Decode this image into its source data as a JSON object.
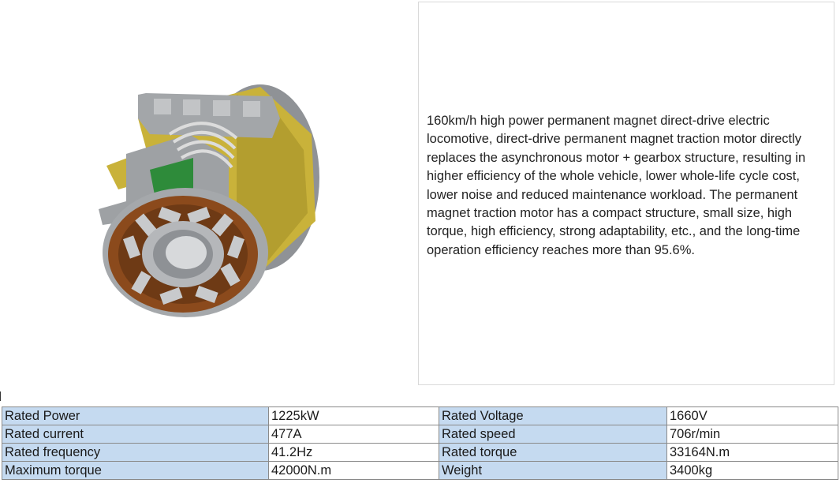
{
  "product": {
    "image_alt": "permanent magnet direct-drive traction motor",
    "description": "160km/h high power permanent magnet direct-drive electric locomotive, direct-drive permanent magnet traction motor directly replaces the asynchronous motor + gearbox structure, resulting in higher efficiency of the whole vehicle, lower whole-life cycle cost, lower noise and reduced maintenance workload. The permanent magnet traction motor has a compact structure, small size, high torque, high efficiency, strong adaptability, etc., and the long-time operation efficiency reaches more than 95.6%."
  },
  "colors": {
    "label_cell_bg": "#c5daf0",
    "border": "#8a8a8a",
    "motor_yellow": "#c9b23a",
    "motor_grey": "#9ea1a4",
    "motor_brown": "#8b4a1c",
    "motor_green": "#2e8b3a"
  },
  "specs": {
    "rows": [
      [
        {
          "label": "Rated Power",
          "value": "1225kW"
        },
        {
          "label": "Rated Voltage",
          "value": "1660V"
        }
      ],
      [
        {
          "label": "Rated current",
          "value": "477A"
        },
        {
          "label": "Rated speed",
          "value": "706r/min"
        }
      ],
      [
        {
          "label": "Rated frequency",
          "value": "41.2Hz"
        },
        {
          "label": "Rated torque",
          "value": "33164N.m"
        }
      ],
      [
        {
          "label": "Maximum torque",
          "value": "42000N.m"
        },
        {
          "label": "Weight",
          "value": "3400kg"
        }
      ]
    ]
  }
}
